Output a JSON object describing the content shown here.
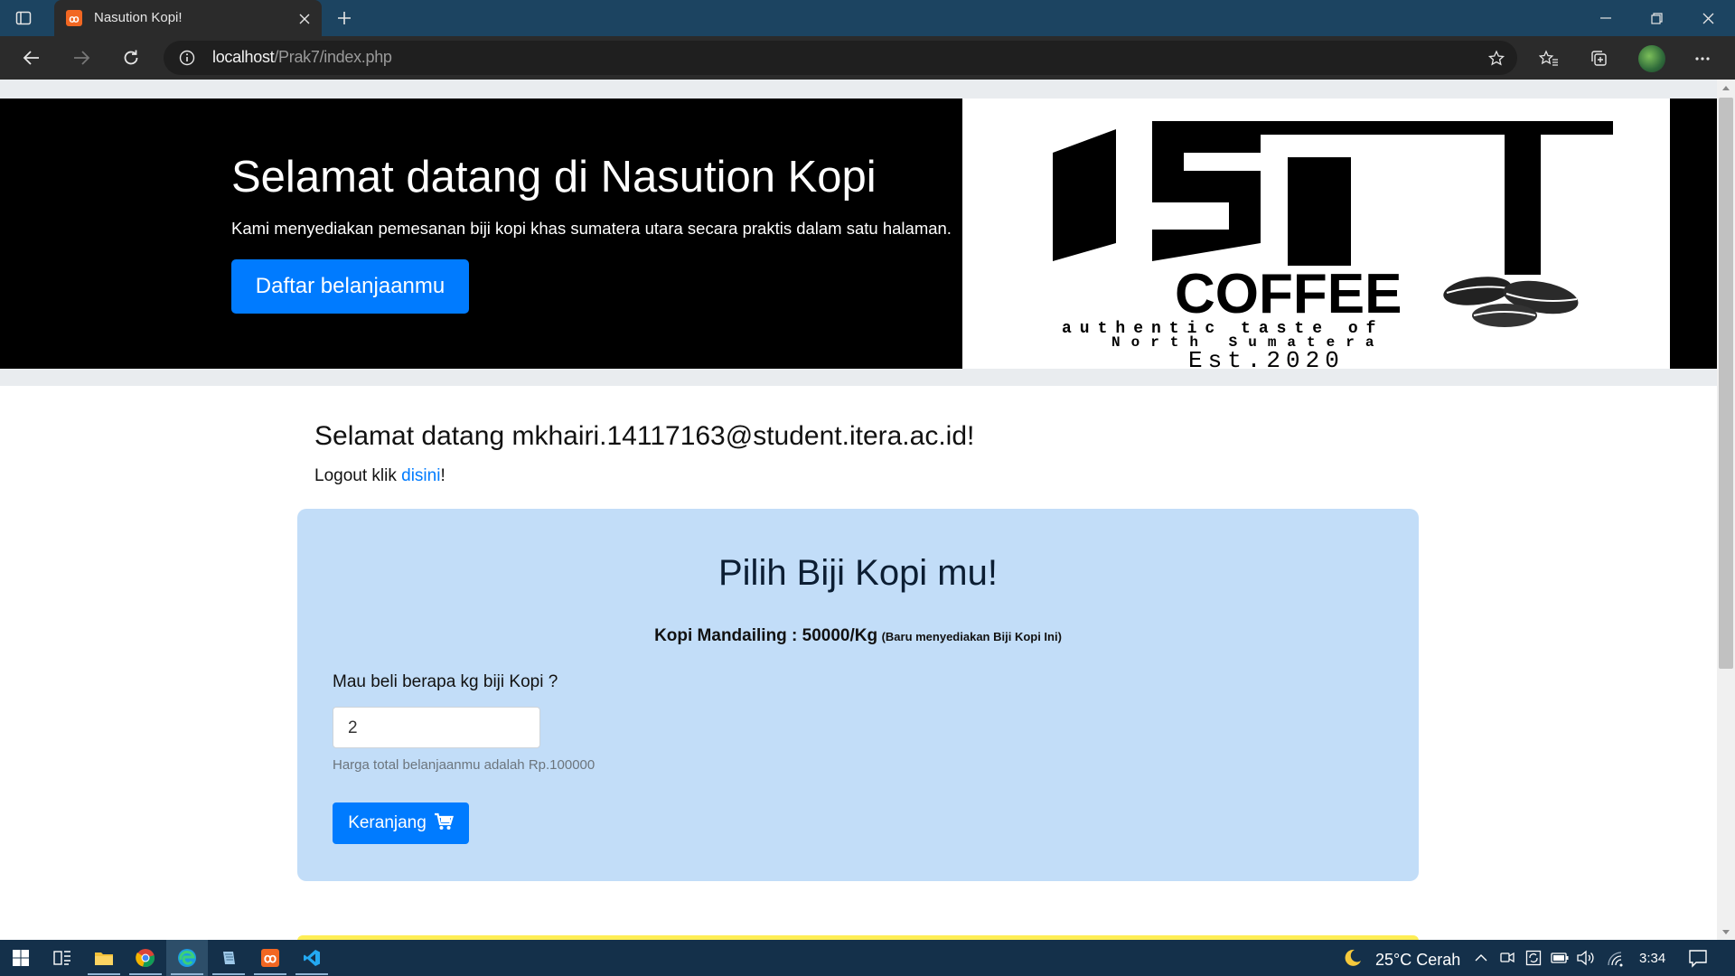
{
  "browser": {
    "tab_title": "Nasution Kopi!",
    "url_host": "localhost",
    "url_path": "/Prak7/index.php"
  },
  "hero": {
    "title": "Selamat datang di Nasution Kopi",
    "subtitle": "Kami menyediakan pemesanan biji kopi khas sumatera utara secara praktis dalam satu halaman.",
    "button_label": "Daftar belanjaanmu",
    "logo": {
      "initials": "NST",
      "brand": "COFFEE",
      "tagline_1": "authentic taste of",
      "tagline_2": "North Sumatera",
      "est": "Est.2020"
    }
  },
  "welcome": {
    "heading": "Selamat datang mkhairi.14117163@student.itera.ac.id!",
    "logout_prefix": "Logout klik ",
    "logout_link": "disini",
    "logout_suffix": "!"
  },
  "order": {
    "title": "Pilih Biji Kopi mu!",
    "product": "Kopi Mandailing : 50000/Kg",
    "product_note": "(Baru menyediakan Biji Kopi Ini)",
    "qty_label": "Mau beli berapa kg biji Kopi ?",
    "qty_value": "2",
    "total_text": "Harga total belanjaanmu adalah Rp.100000",
    "cart_label": "Keranjang"
  },
  "taskbar": {
    "weather": "25°C  Cerah",
    "time": "3:34"
  },
  "colors": {
    "accent": "#007bff",
    "card_bg": "#c2ddf8",
    "tabbar": "#1c4461"
  }
}
